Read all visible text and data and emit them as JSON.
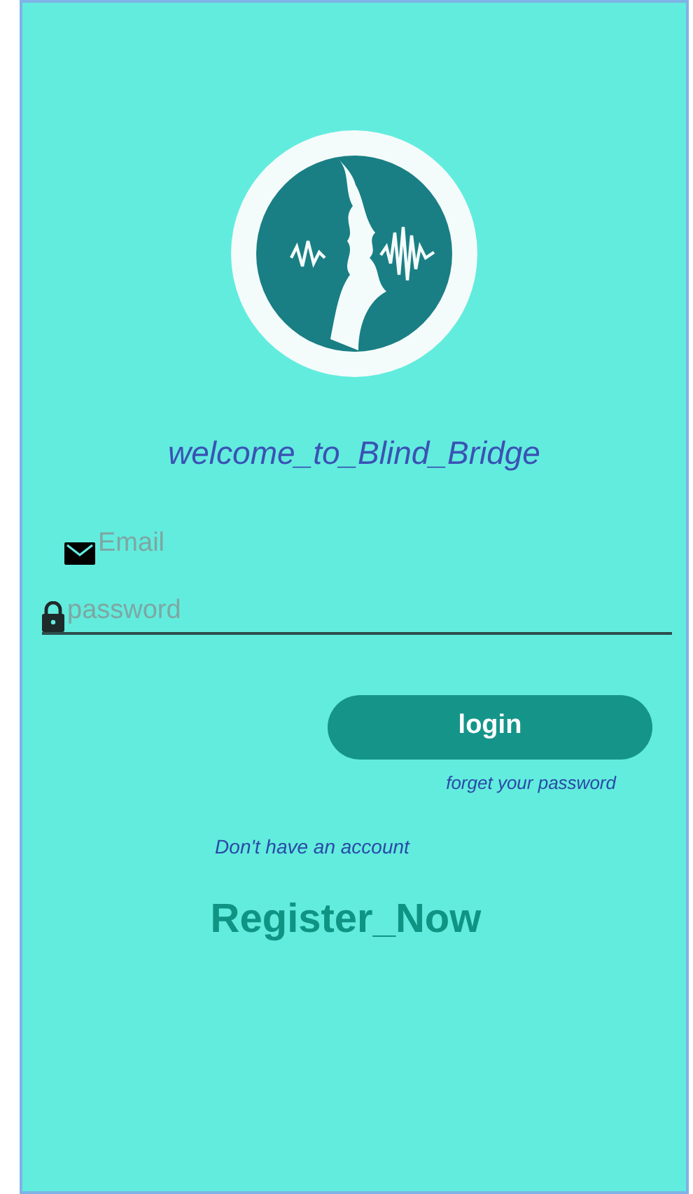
{
  "title": "welcome_to_Blind_Bridge",
  "fields": [
    {
      "kind": "email",
      "placeholder": "Email",
      "underlined": false
    },
    {
      "kind": "password",
      "placeholder": "password",
      "underlined": true
    }
  ],
  "login_button": "login",
  "forgot_link": "forget your password",
  "no_account_text": "Don't have an account",
  "register_link": "Register_Now"
}
